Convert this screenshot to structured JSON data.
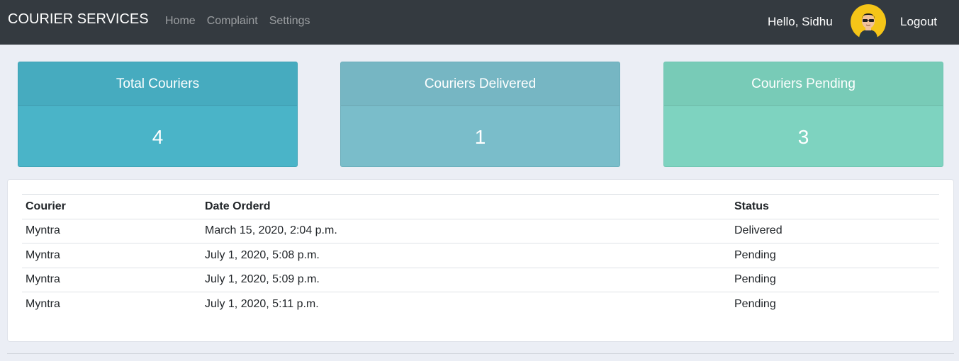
{
  "navbar": {
    "brand": "COURIER SERVICES",
    "links": [
      "Home",
      "Complaint",
      "Settings"
    ],
    "greeting": "Hello, Sidhu",
    "logout": "Logout"
  },
  "cards": {
    "total": {
      "title": "Total Couriers",
      "value": "4"
    },
    "delivered": {
      "title": "Couriers Delivered",
      "value": "1"
    },
    "pending": {
      "title": "Couriers Pending",
      "value": "3"
    }
  },
  "table": {
    "headers": [
      "Courier",
      "Date Orderd",
      "Status"
    ],
    "rows": [
      [
        "Myntra",
        "March 15, 2020, 2:04 p.m.",
        "Delivered"
      ],
      [
        "Myntra",
        "July 1, 2020, 5:08 p.m.",
        "Pending"
      ],
      [
        "Myntra",
        "July 1, 2020, 5:09 p.m.",
        "Pending"
      ],
      [
        "Myntra",
        "July 1, 2020, 5:11 p.m.",
        "Pending"
      ]
    ]
  },
  "colors": {
    "navbar": "#343a40",
    "card_total": "#4ab4c8",
    "card_delivered": "#7abdca",
    "card_pending": "#7ed3c0",
    "avatar_bg": "#f5c518"
  },
  "icons": {
    "avatar": "user-with-sunglasses-icon"
  }
}
